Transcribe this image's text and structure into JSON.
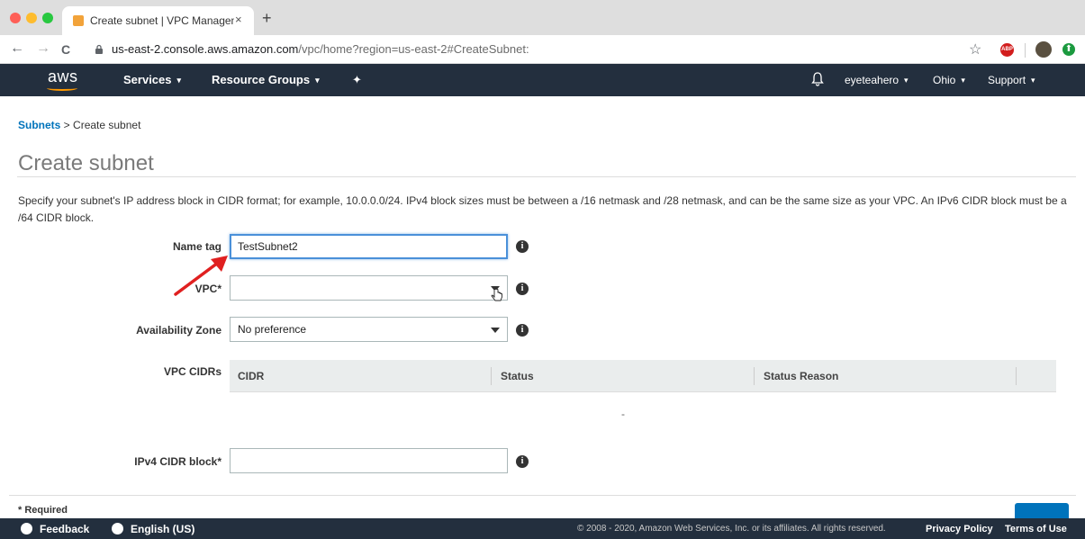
{
  "browser": {
    "tab_title": "Create subnet | VPC Managem",
    "tab_close": "×",
    "new_tab": "+",
    "url_host": "us-east-2.console.aws.amazon.com",
    "url_path": "/vpc/home?region=us-east-2#CreateSubnet:",
    "back": "←",
    "forward": "→",
    "reload": "C",
    "bookmark_star": "☆",
    "abp_label": "ABP",
    "ext_icon": "⬆"
  },
  "aws_nav": {
    "logo": "aws",
    "services": "Services",
    "resource_groups": "Resource Groups",
    "pin": "✦",
    "account": "eyeteahero",
    "region": "Ohio",
    "support": "Support",
    "caret": "▾"
  },
  "breadcrumb": {
    "parent": "Subnets",
    "separator": " > ",
    "current": "Create subnet"
  },
  "page": {
    "title": "Create subnet",
    "description": "Specify your subnet's IP address block in CIDR format; for example, 10.0.0.0/24. IPv4 block sizes must be between a /16 netmask and /28 netmask, and can be the same size as your VPC. An IPv6 CIDR block must be a /64 CIDR block."
  },
  "form": {
    "name_tag_label": "Name tag",
    "name_tag_value": "TestSubnet2",
    "vpc_label": "VPC*",
    "vpc_value": "",
    "az_label": "Availability Zone",
    "az_value": "No preference",
    "vpc_cidrs_label": "VPC CIDRs",
    "cidr_columns": [
      "CIDR",
      "Status",
      "Status Reason"
    ],
    "cidr_empty": "-",
    "ipv4_label": "IPv4 CIDR block*",
    "ipv4_value": "",
    "info_glyph": "i",
    "required_note": "* Required"
  },
  "footer": {
    "feedback": "Feedback",
    "language": "English (US)",
    "copyright": "© 2008 - 2020, Amazon Web Services, Inc. or its affiliates. All rights reserved.",
    "privacy": "Privacy Policy",
    "terms": "Terms of Use"
  },
  "colors": {
    "aws_nav_bg": "#232f3e",
    "link_blue": "#0073bb",
    "annotation_red": "#e02020"
  }
}
